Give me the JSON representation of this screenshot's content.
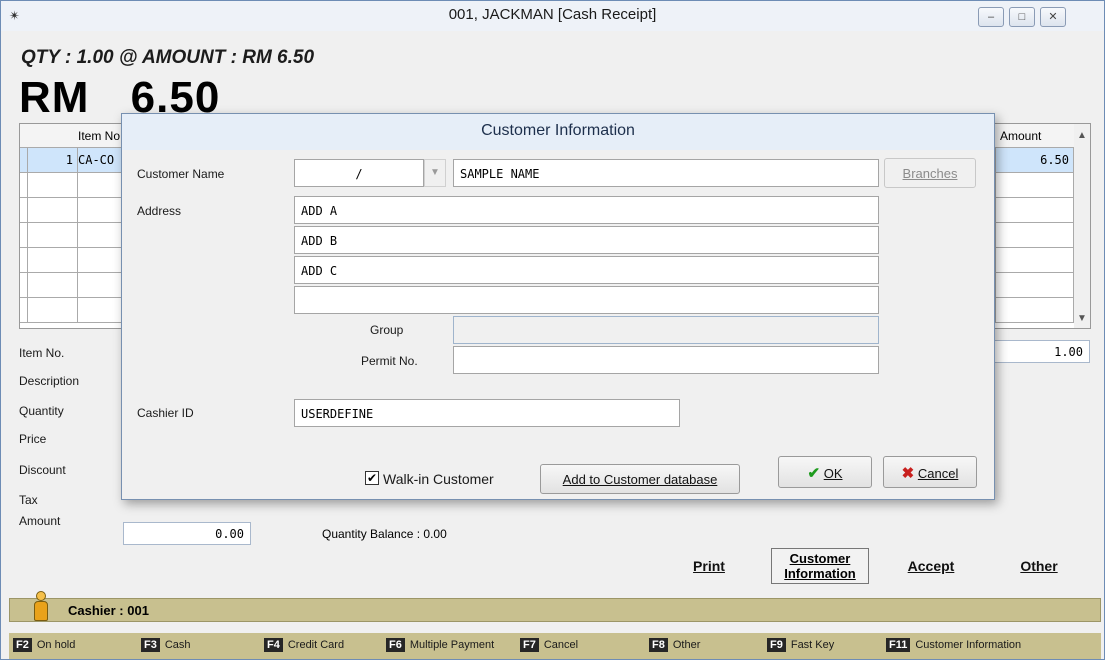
{
  "window": {
    "title": "001, JACKMAN [Cash Receipt]",
    "app_icon": "glasses-icon",
    "controls": [
      "minimize",
      "maximize",
      "close"
    ]
  },
  "summary": {
    "qty_line": "QTY : 1.00  @  AMOUNT : RM  6.50",
    "rm_label": "RM",
    "total": "6.50"
  },
  "grid": {
    "columns": [
      "Item No",
      "Amount"
    ],
    "rows": [
      {
        "no": "1",
        "item": "CA-CO",
        "amount": "6.50"
      }
    ]
  },
  "form": {
    "labels": {
      "item_no": "Item No.",
      "description": "Description",
      "quantity": "Quantity",
      "price": "Price",
      "discount": "Discount",
      "tax": "Tax",
      "amount": "Amount"
    },
    "right_value": "1.00",
    "amount_value": "0.00",
    "quantity_balance": "Quantity Balance : 0.00"
  },
  "actions": {
    "print": "Print",
    "customer_info_1": "Customer",
    "customer_info_2": "Information",
    "accept": "Accept",
    "other": "Other"
  },
  "cashier": {
    "text": "Cashier : 001"
  },
  "fkeys": [
    {
      "key": "F2",
      "label": "On hold"
    },
    {
      "key": "F3",
      "label": "Cash"
    },
    {
      "key": "F4",
      "label": "Credit Card"
    },
    {
      "key": "F6",
      "label": "Multiple Payment"
    },
    {
      "key": "F7",
      "label": "Cancel"
    },
    {
      "key": "F8",
      "label": "Other"
    },
    {
      "key": "F9",
      "label": "Fast Key"
    },
    {
      "key": "F11",
      "label": "Customer Information"
    }
  ],
  "dialog": {
    "title": "Customer Information",
    "labels": {
      "customer_name": "Customer Name",
      "address": "Address",
      "group": "Group",
      "permit_no": "Permit No.",
      "cashier_id": "Cashier ID"
    },
    "customer_code": "/",
    "customer_name": "SAMPLE NAME",
    "address": [
      "ADD A",
      "ADD B",
      "ADD C",
      ""
    ],
    "group": "",
    "permit_no": "",
    "cashier_id": "USERDEFINE",
    "walk_in_label": "Walk-in Customer",
    "walk_in_checked": true,
    "buttons": {
      "branches": "Branches",
      "add_db": "Add to Customer database",
      "ok": "OK",
      "cancel": "Cancel"
    }
  }
}
